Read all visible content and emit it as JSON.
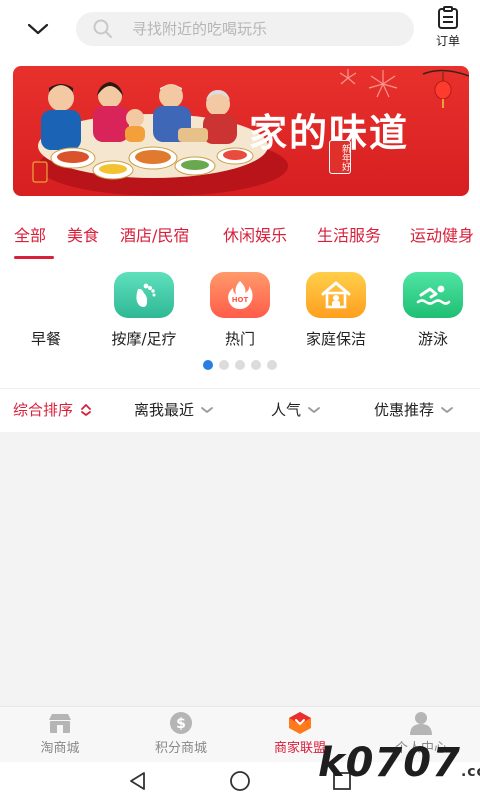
{
  "header": {
    "search_placeholder": "寻找附近的吃喝玩乐",
    "order_label": "订单"
  },
  "banner": {
    "title": "家的味道",
    "seal": "新年好"
  },
  "tabs": [
    "全部",
    "美食",
    "酒店/民宿",
    "休闲娱乐",
    "生活服务",
    "运动健身"
  ],
  "active_tab": "全部",
  "icons": {
    "first_label": "早餐",
    "items": [
      {
        "label": "按摩/足疗",
        "icon": "foot-massage-icon",
        "color": "#3cc6a6"
      },
      {
        "label": "热门",
        "icon": "hot-flame-icon",
        "color": "#ff7a52"
      },
      {
        "label": "家庭保洁",
        "icon": "house-cleaning-icon",
        "color": "#ffb22e"
      },
      {
        "label": "游泳",
        "icon": "swimming-icon",
        "color": "#2ecb86"
      }
    ]
  },
  "filters": [
    {
      "label": "综合排序",
      "active": true
    },
    {
      "label": "离我最近"
    },
    {
      "label": "人气"
    },
    {
      "label": "优惠推荐"
    }
  ],
  "bottom_nav": [
    {
      "label": "淘商城",
      "icon": "store-icon"
    },
    {
      "label": "积分商城",
      "icon": "coin-icon"
    },
    {
      "label": "商家联盟",
      "icon": "merchant-icon",
      "active": true
    },
    {
      "label": "个人中心",
      "icon": "person-icon"
    }
  ],
  "watermark": {
    "text": "k0707",
    "suffix": ".com"
  },
  "colors": {
    "accent": "#d8203b",
    "banner": "#e02a28",
    "dot_active": "#2a7de1"
  }
}
